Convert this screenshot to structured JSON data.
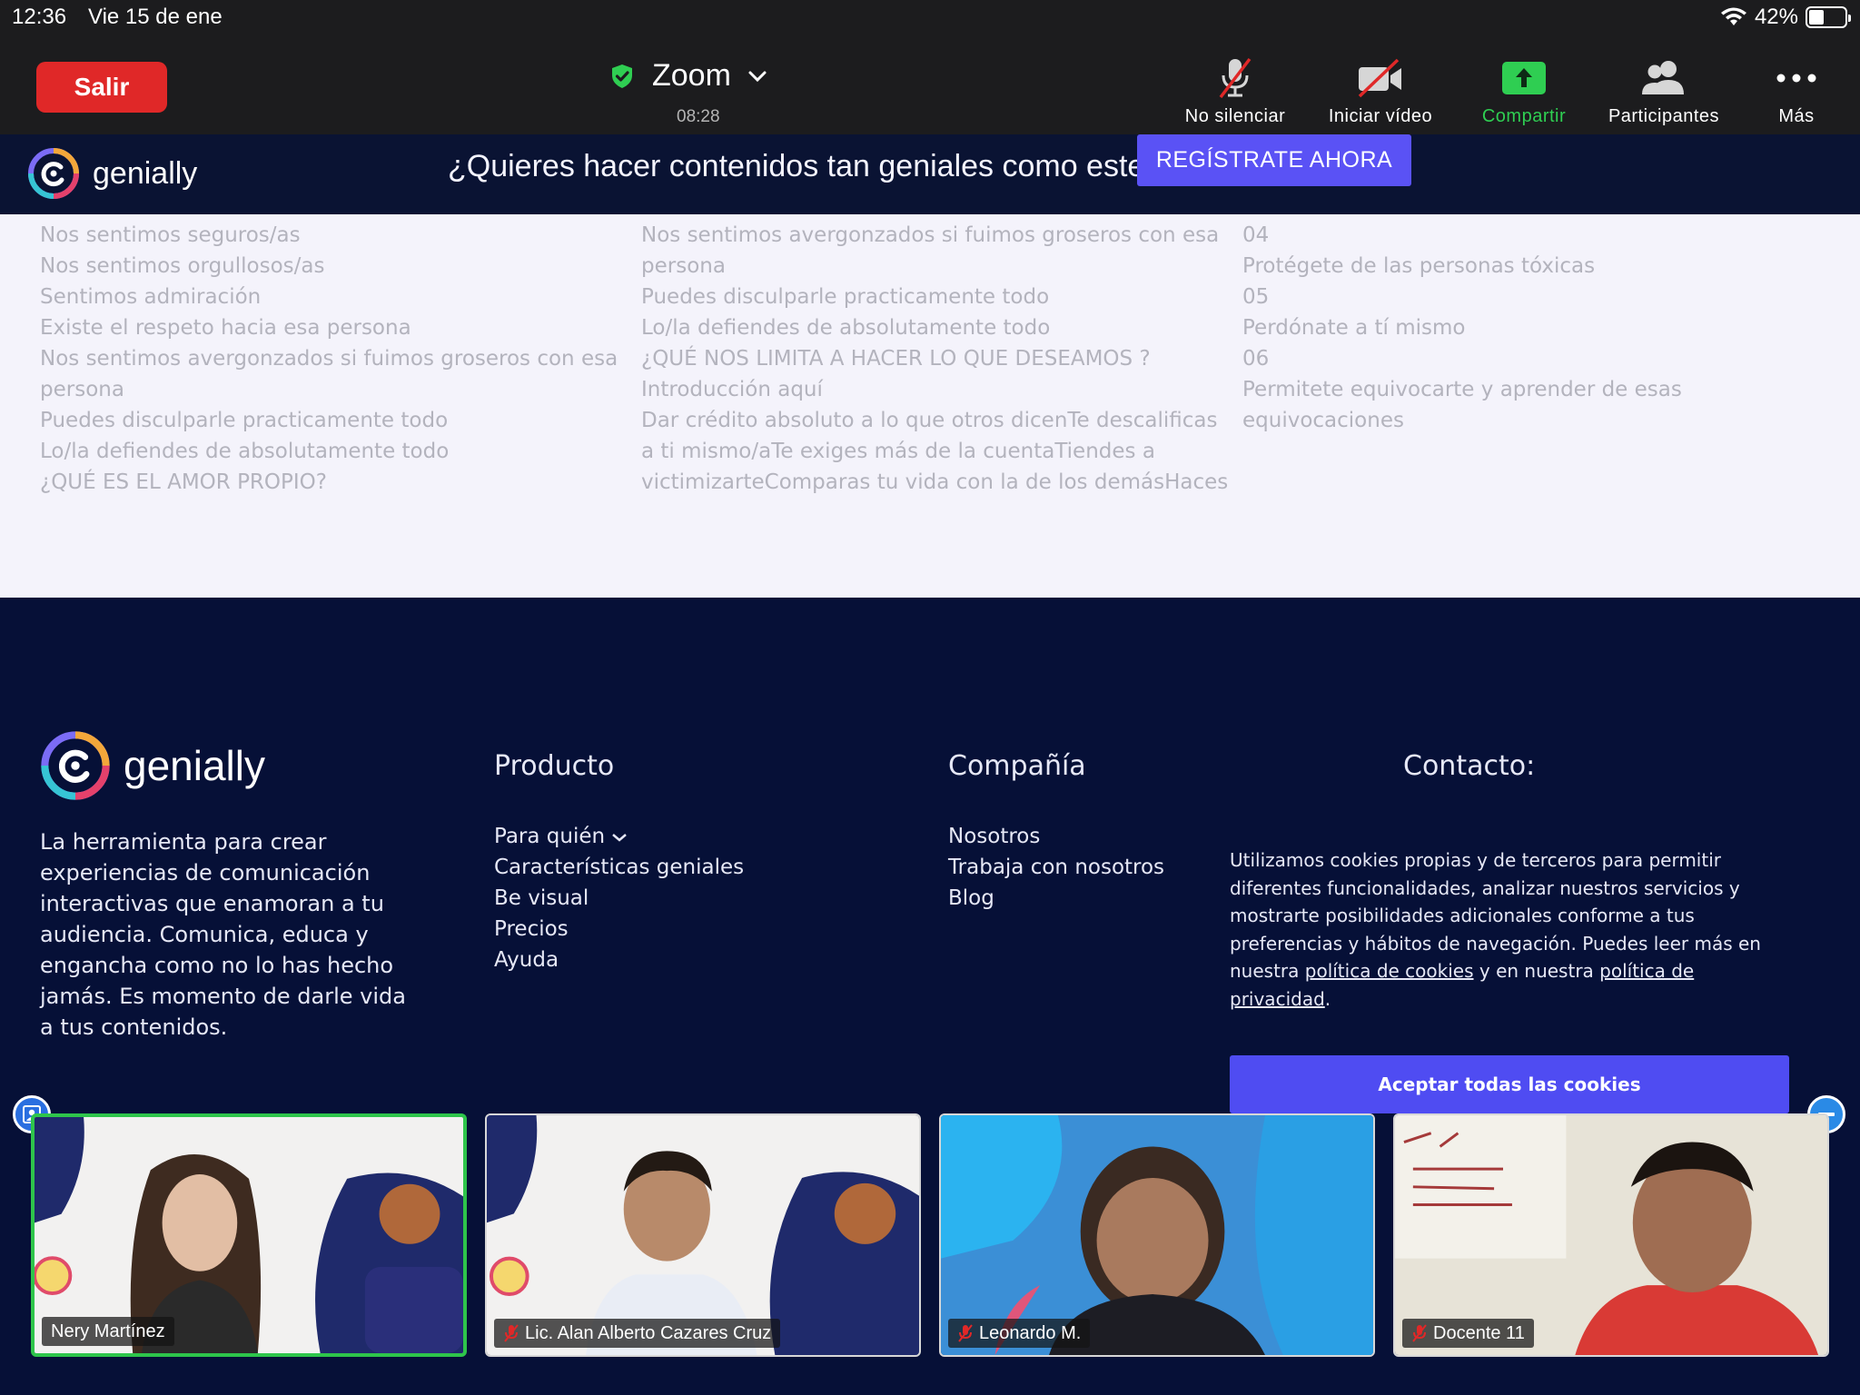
{
  "status_bar": {
    "time": "12:36",
    "date": "Vie 15 de ene",
    "battery": "42%",
    "battery_level": 0.42
  },
  "toolbar": {
    "leave_label": "Salir",
    "meeting_title": "Zoom",
    "meeting_timer": "08:28",
    "tools": [
      {
        "id": "mute",
        "label": "No silenciar",
        "icon": "mic-muted-icon"
      },
      {
        "id": "video",
        "label": "Iniciar vídeo",
        "icon": "video-off-icon"
      },
      {
        "id": "share",
        "label": "Compartir",
        "icon": "share-screen-icon",
        "color": "#2fce52"
      },
      {
        "id": "participants",
        "label": "Participantes",
        "icon": "participants-icon"
      },
      {
        "id": "more",
        "label": "Más",
        "icon": "more-dots-icon"
      }
    ]
  },
  "genially": {
    "brand": "genially",
    "banner_question": "¿Quieres hacer contenidos tan geniales como este?",
    "register_label": "REGÍSTRATE AHORA",
    "columns": [
      [
        "Nos sentimos seguros/as",
        "Nos sentimos orgullosos/as",
        "Sentimos admiración",
        "Existe el respeto hacia esa persona",
        "Nos sentimos avergonzados si fuimos groseros con esa",
        "persona",
        "Puedes disculparle practicamente todo",
        "Lo/la defiendes de absolutamente todo",
        "¿QUÉ ES EL AMOR PROPIO?"
      ],
      [
        "Nos sentimos avergonzados si fuimos groseros con esa",
        "persona",
        "Puedes disculparle practicamente todo",
        "Lo/la defiendes de absolutamente todo",
        "¿QUÉ NOS LIMITA A HACER LO QUE DESEAMOS ?",
        "Introducción aquí",
        "Dar crédito absoluto a lo que otros dicenTe descalificas",
        "a ti mismo/aTe exiges más de la cuentaTiendes a",
        "victimizarteComparas tu vida con la de los demásHaces"
      ],
      [
        "04",
        "Protégete de las personas tóxicas",
        "05",
        "Perdónate a tí mismo",
        "06",
        "Permitete equivocarte y aprender de esas",
        "equivocaciones"
      ]
    ],
    "footer": {
      "description": "La herramienta para crear experiencias de comunicación interactivas que enamoran a tu audiencia. Comunica, educa y engancha como no lo has hecho jamás. Es momento de darle vida a tus contenidos.",
      "producto": {
        "heading": "Producto",
        "items": [
          "Para quién",
          "Características geniales",
          "Be visual",
          "Precios",
          "Ayuda"
        ]
      },
      "compania": {
        "heading": "Compañía",
        "items": [
          "Nosotros",
          "Trabaja con nosotros",
          "Blog"
        ]
      },
      "contacto": {
        "heading": "Contacto:"
      },
      "cookies": {
        "text_1": "Utilizamos cookies propias y de terceros para permitir diferentes funcionalidades, analizar nuestros servicios y mostrarte posibilidades adicionales conforme a tus preferencias y hábitos de navegación. Puedes leer más en nuestra ",
        "link_1": "política de cookies",
        "text_2": " y en nuestra ",
        "link_2": "política de privacidad",
        "text_3": ".",
        "accept_label": "Aceptar todas las cookies"
      }
    }
  },
  "participants": [
    {
      "name": "Nery Martínez",
      "muted": false,
      "active": true
    },
    {
      "name": "Lic. Alan Alberto Cazares Cruz",
      "muted": true,
      "active": false
    },
    {
      "name": "Leonardo M.",
      "muted": true,
      "active": false
    },
    {
      "name": "Docente 11",
      "muted": true,
      "active": false
    }
  ],
  "colors": {
    "accent_green": "#2fce52",
    "leave_red": "#e02828",
    "genially_blue": "#5a52f5",
    "footer_bg": "#061037"
  }
}
